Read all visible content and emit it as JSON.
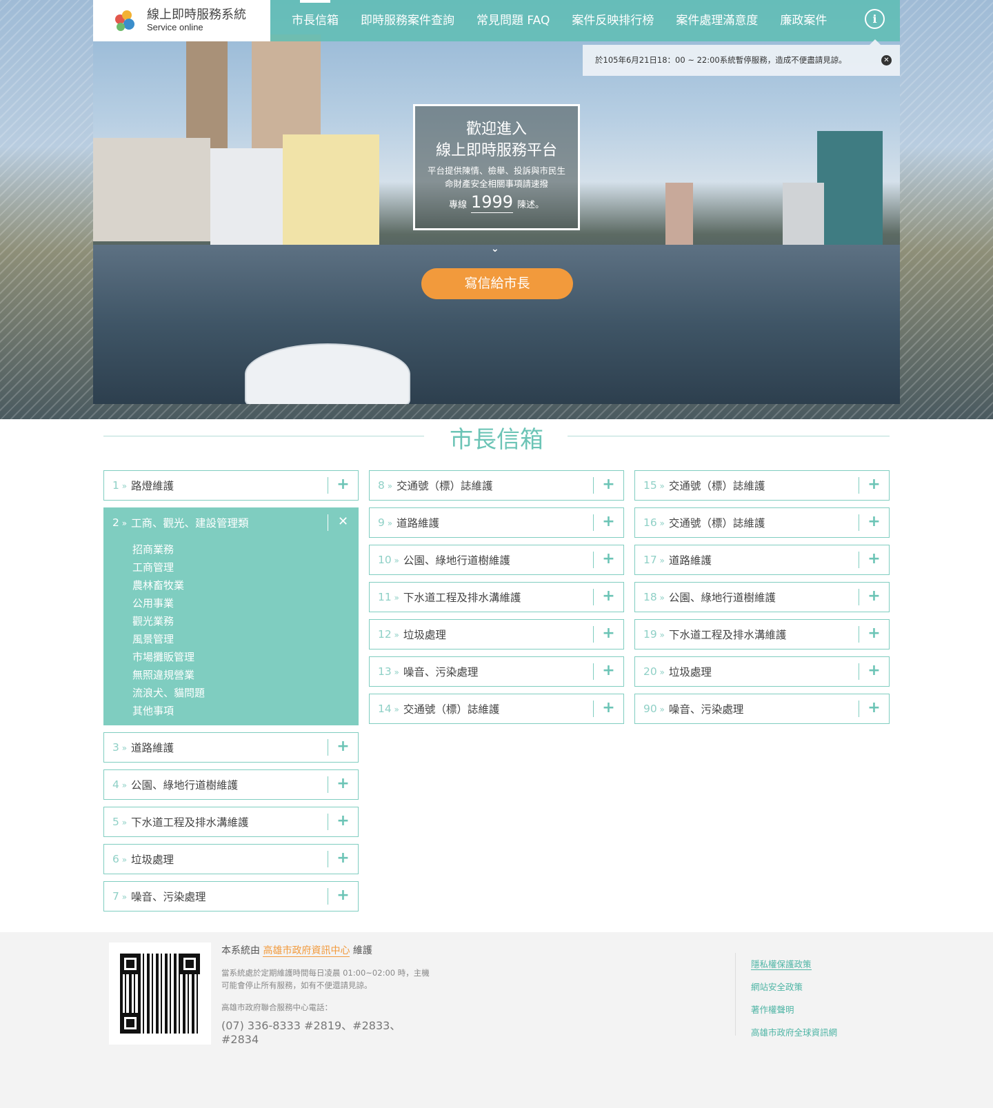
{
  "logo": {
    "title": "線上即時服務系統",
    "subtitle": "Service online"
  },
  "nav": [
    "市長信箱",
    "即時服務案件查詢",
    "常見問題 FAQ",
    "案件反映排行榜",
    "案件處理滿意度",
    "廉政案件"
  ],
  "notice": "於105年6月21日18：00 ~ 22:00系統暫停服務，造成不便盡請見諒。",
  "welcome": {
    "line1": "歡迎進入",
    "line2": "線上即時服務平台",
    "desc": "平台提供陳情、檢舉、投訴與市民生命財產安全相關事項請速撥",
    "hotline_prefix": "專線",
    "hotline": "1999",
    "hotline_suffix": "陳述。"
  },
  "cta": "寫信給市長",
  "section_title": "市長信箱",
  "col1": {
    "before": [
      {
        "num": "1",
        "label": "路燈維護"
      }
    ],
    "open": {
      "num": "2",
      "label": "工商、觀光、建設管理類",
      "sub": [
        "招商業務",
        "工商管理",
        "農林畜牧業",
        "公用事業",
        "觀光業務",
        "風景管理",
        "市場攤販管理",
        "無照違規營業",
        "流浪犬、貓問題",
        "其他事項"
      ]
    },
    "after": [
      {
        "num": "3",
        "label": "道路維護"
      },
      {
        "num": "4",
        "label": "公園、綠地行道樹維護"
      },
      {
        "num": "5",
        "label": "下水道工程及排水溝維護"
      },
      {
        "num": "6",
        "label": "垃圾處理"
      },
      {
        "num": "7",
        "label": "噪音、污染處理"
      }
    ]
  },
  "col2": [
    {
      "num": "8",
      "label": "交通號（標）誌維護"
    },
    {
      "num": "9",
      "label": "道路維護"
    },
    {
      "num": "10",
      "label": "公園、綠地行道樹維護"
    },
    {
      "num": "11",
      "label": "下水道工程及排水溝維護"
    },
    {
      "num": "12",
      "label": "垃圾處理"
    },
    {
      "num": "13",
      "label": "噪音、污染處理"
    },
    {
      "num": "14",
      "label": "交通號（標）誌維護"
    }
  ],
  "col3": [
    {
      "num": "15",
      "label": "交通號（標）誌維護"
    },
    {
      "num": "16",
      "label": "交通號（標）誌維護"
    },
    {
      "num": "17",
      "label": "道路維護"
    },
    {
      "num": "18",
      "label": "公園、綠地行道樹維護"
    },
    {
      "num": "19",
      "label": "下水道工程及排水溝維護"
    },
    {
      "num": "20",
      "label": "垃圾處理"
    },
    {
      "num": "90",
      "label": "噪音、污染處理"
    }
  ],
  "footer": {
    "maintained_prefix": "本系統由",
    "maintainer": "高雄市政府資訊中心",
    "maintained_suffix": "維護",
    "note": "當系統處於定期維護時間每日凌晨 01:00~02:00 時，主機可能會停止所有服務，如有不便還請見諒。",
    "phone_label": "高雄市政府聯合服務中心電話：",
    "phone": "(07) 336-8333 #2819、#2833、#2834",
    "links": [
      "隱私權保護政策",
      "網站安全政策",
      "著作權聲明",
      "高雄市政府全球資訊網"
    ]
  },
  "colors": {
    "teal": "#7fcdc0",
    "title_teal": "#6cc4b6",
    "orange": "#f29a3c"
  },
  "icons": {
    "expand": "plus-icon",
    "collapse": "close-icon",
    "info": "info-icon"
  }
}
